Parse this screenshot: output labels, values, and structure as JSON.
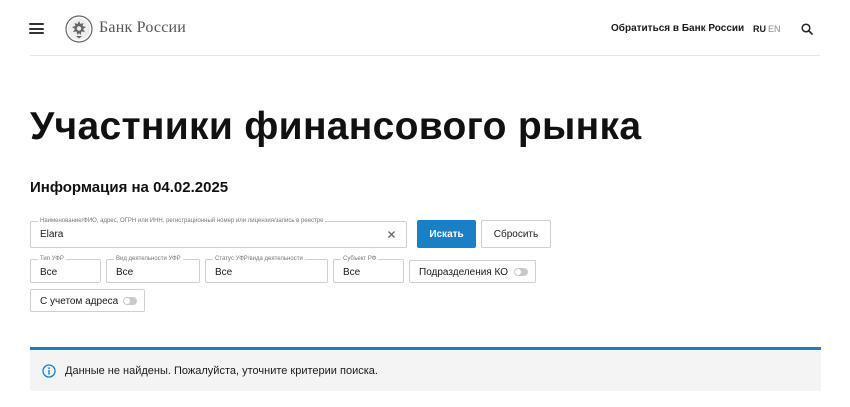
{
  "header": {
    "logo_text": "Банк России",
    "contact_link": "Обратиться в Банк России",
    "lang_ru": "RU",
    "lang_en": "EN"
  },
  "page": {
    "title": "Участники финансового рынка",
    "info": "Информация на 04.02.2025"
  },
  "search": {
    "label": "Наименование/ФИО, адрес, ОГРН или ИНН, регистрационный номер или лицензия/запись в реестре",
    "value": "Elara",
    "search_button": "Искать",
    "reset_button": "Сбросить"
  },
  "filters": [
    {
      "label": "Тип УФР",
      "value": "Все"
    },
    {
      "label": "Вид деятельности УФР",
      "value": "Все"
    },
    {
      "label": "Статус УФР/вида деятельности",
      "value": "Все"
    },
    {
      "label": "Субъект РФ",
      "value": "Все"
    }
  ],
  "toggles": {
    "subdivisions": {
      "label": "Подразделения КО",
      "on": false
    },
    "with_address": {
      "label": "С учетом адреса",
      "on": false
    }
  },
  "alert": {
    "text": "Данные не найдены. Пожалуйста, уточните критерии поиска.",
    "accent": "#1a7fc5"
  },
  "colors": {
    "primary": "#1a7fc5",
    "border": "#cfcfcf",
    "alert_bg": "#f4f4f4"
  }
}
